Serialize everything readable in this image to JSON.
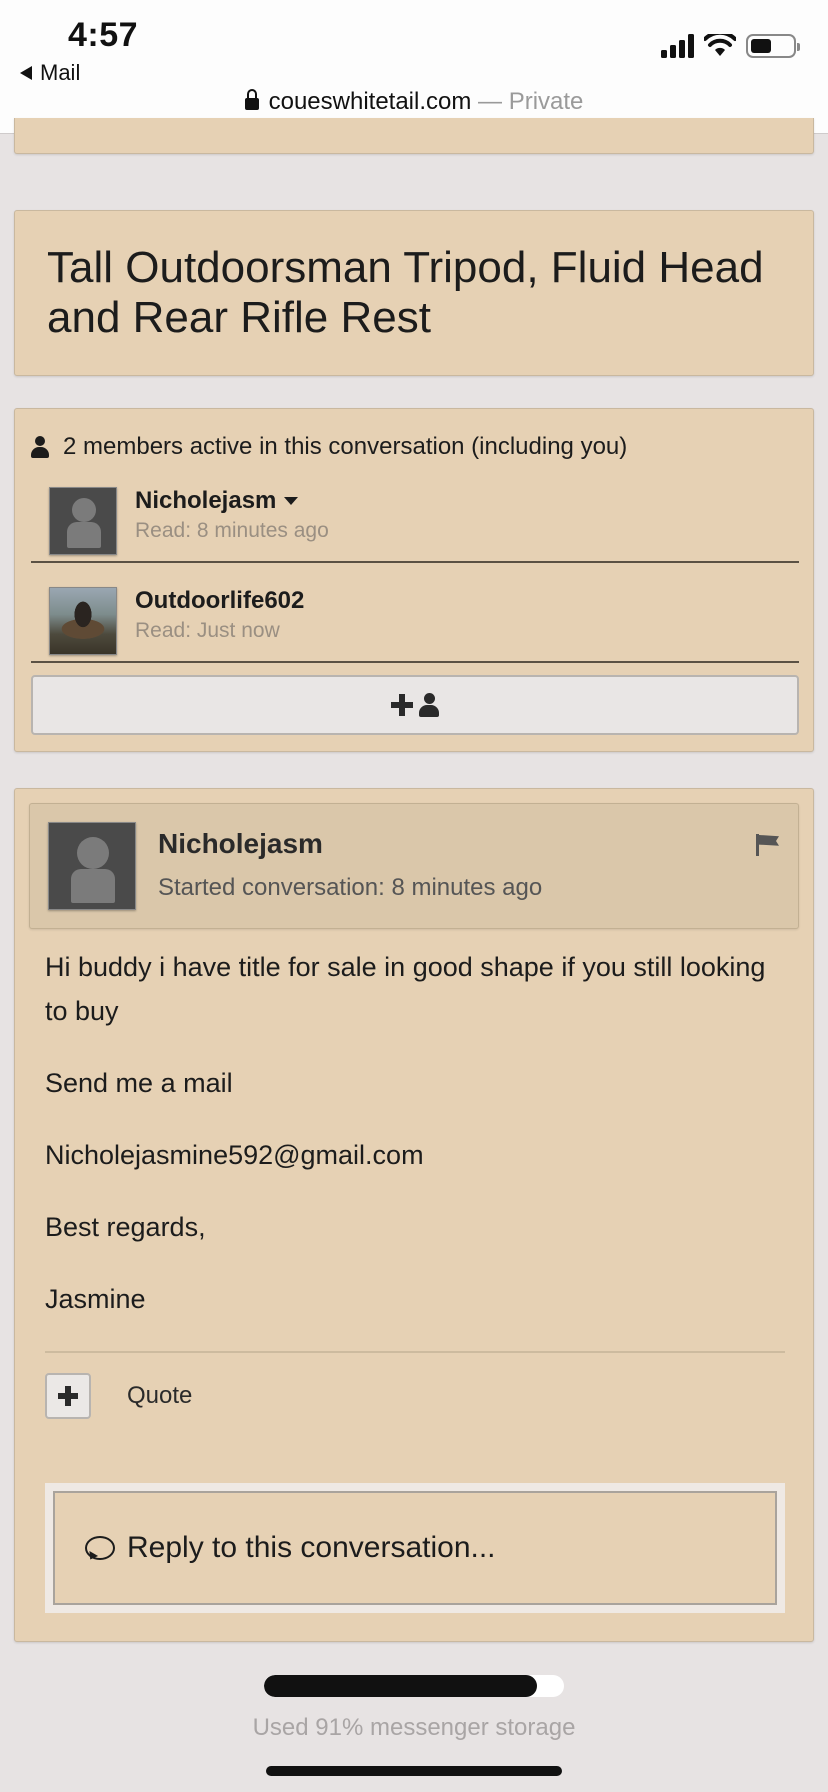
{
  "status_bar": {
    "time": "4:57",
    "back_app": "Mail",
    "url_domain": "coueswhitetail.com",
    "url_suffix": " — Private",
    "battery_percent": 50
  },
  "conversation": {
    "title": "Tall Outdoorsman Tripod, Fluid Head and Rear Rifle Rest"
  },
  "members": {
    "heading": "2 members active in this conversation (including you)",
    "list": [
      {
        "name": "Nicholejasm",
        "read": "Read: 8 minutes ago"
      },
      {
        "name": "Outdoorlife602",
        "read": "Read: Just now"
      }
    ]
  },
  "message": {
    "author": "Nicholejasm",
    "meta": "Started conversation: 8 minutes ago",
    "paragraphs": [
      "Hi buddy i have title for sale in good shape if you still looking to buy",
      "Send me a mail",
      "Nicholejasmine592@gmail.com",
      "Best regards,",
      "Jasmine"
    ],
    "quote_label": "Quote"
  },
  "reply": {
    "placeholder": "Reply to this conversation..."
  },
  "storage": {
    "used_fraction": 0.91,
    "text": "Used 91% messenger storage"
  }
}
